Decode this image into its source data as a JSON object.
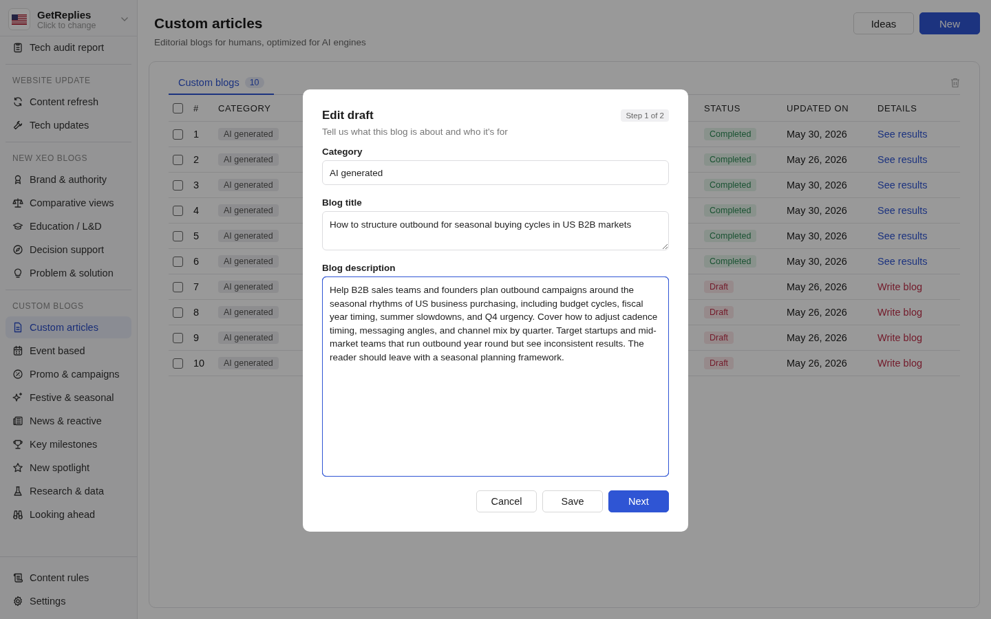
{
  "sidebar": {
    "workspace": {
      "name": "GetReplies",
      "subtitle": "Click to change"
    },
    "top_items": [
      {
        "label": "Tech audit report",
        "selected": false
      }
    ],
    "sections": [
      {
        "title": "WEBSITE UPDATE",
        "items": [
          {
            "label": "Content refresh",
            "selected": false
          },
          {
            "label": "Tech updates",
            "selected": false
          }
        ]
      },
      {
        "title": "NEW XEO BLOGS",
        "items": [
          {
            "label": "Brand & authority",
            "selected": false
          },
          {
            "label": "Comparative views",
            "selected": false
          },
          {
            "label": "Education / L&D",
            "selected": false
          },
          {
            "label": "Decision support",
            "selected": false
          },
          {
            "label": "Problem & solution",
            "selected": false
          }
        ]
      },
      {
        "title": "CUSTOM BLOGS",
        "items": [
          {
            "label": "Custom articles",
            "selected": true
          },
          {
            "label": "Event based",
            "selected": false
          },
          {
            "label": "Promo & campaigns",
            "selected": false
          },
          {
            "label": "Festive & seasonal",
            "selected": false
          },
          {
            "label": "News & reactive",
            "selected": false
          },
          {
            "label": "Key milestones",
            "selected": false
          },
          {
            "label": "New spotlight",
            "selected": false
          },
          {
            "label": "Research & data",
            "selected": false
          },
          {
            "label": "Looking ahead",
            "selected": false
          }
        ]
      }
    ],
    "bottom_items": [
      {
        "label": "Content rules",
        "selected": false
      },
      {
        "label": "Settings",
        "selected": false
      }
    ]
  },
  "header": {
    "title": "Custom articles",
    "subtitle": "Editorial blogs for humans, optimized for AI engines",
    "buttons": [
      {
        "label": "Ideas",
        "kind": "secondary"
      },
      {
        "label": "New",
        "kind": "primary"
      }
    ]
  },
  "tabs": [
    {
      "label": "Custom blogs",
      "count": "10",
      "selected": true
    }
  ],
  "table": {
    "select_all": {
      "checked": false
    },
    "columns": [
      "#",
      "CATEGORY",
      "STATUS",
      "UPDATED ON",
      "DETAILS"
    ],
    "rows": [
      {
        "checked": false,
        "number": "1",
        "category": "AI generated",
        "status": {
          "label": "Completed",
          "kind": "completed"
        },
        "updated": "May 30, 2026",
        "details": {
          "label": "See results",
          "kind": "results"
        }
      },
      {
        "checked": false,
        "number": "2",
        "category": "AI generated",
        "status": {
          "label": "Completed",
          "kind": "completed"
        },
        "updated": "May 26, 2026",
        "details": {
          "label": "See results",
          "kind": "results"
        }
      },
      {
        "checked": false,
        "number": "3",
        "category": "AI generated",
        "status": {
          "label": "Completed",
          "kind": "completed"
        },
        "updated": "May 30, 2026",
        "details": {
          "label": "See results",
          "kind": "results"
        }
      },
      {
        "checked": false,
        "number": "4",
        "category": "AI generated",
        "status": {
          "label": "Completed",
          "kind": "completed"
        },
        "updated": "May 30, 2026",
        "details": {
          "label": "See results",
          "kind": "results"
        }
      },
      {
        "checked": false,
        "number": "5",
        "category": "AI generated",
        "status": {
          "label": "Completed",
          "kind": "completed"
        },
        "updated": "May 30, 2026",
        "details": {
          "label": "See results",
          "kind": "results"
        }
      },
      {
        "checked": false,
        "number": "6",
        "category": "AI generated",
        "status": {
          "label": "Completed",
          "kind": "completed"
        },
        "updated": "May 30, 2026",
        "details": {
          "label": "See results",
          "kind": "results"
        }
      },
      {
        "checked": false,
        "number": "7",
        "category": "AI generated",
        "status": {
          "label": "Draft",
          "kind": "draft"
        },
        "updated": "May 26, 2026",
        "details": {
          "label": "Write blog",
          "kind": "write"
        }
      },
      {
        "checked": false,
        "number": "8",
        "category": "AI generated",
        "status": {
          "label": "Draft",
          "kind": "draft"
        },
        "updated": "May 26, 2026",
        "details": {
          "label": "Write blog",
          "kind": "write"
        }
      },
      {
        "checked": false,
        "number": "9",
        "category": "AI generated",
        "status": {
          "label": "Draft",
          "kind": "draft"
        },
        "updated": "May 26, 2026",
        "details": {
          "label": "Write blog",
          "kind": "write"
        }
      },
      {
        "checked": false,
        "number": "10",
        "category": "AI generated",
        "status": {
          "label": "Draft",
          "kind": "draft"
        },
        "updated": "May 26, 2026",
        "details": {
          "label": "Write blog",
          "kind": "write"
        }
      }
    ]
  },
  "modal": {
    "title": "Edit draft",
    "step": "Step 1 of 2",
    "subtitle": "Tell us what this blog is about and who it's for",
    "fields": [
      {
        "label": "Category",
        "value": "AI generated",
        "kind": "input"
      },
      {
        "label": "Blog title",
        "value": "How to structure outbound for seasonal buying cycles in US B2B markets",
        "kind": "textarea"
      },
      {
        "label": "Blog description",
        "value": "Help B2B sales teams and founders plan outbound campaigns around the seasonal rhythms of US business purchasing, including budget cycles, fiscal year timing, summer slowdowns, and Q4 urgency. Cover how to adjust cadence timing, messaging angles, and channel mix by quarter. Target startups and mid-market teams that run outbound year round but see inconsistent results. The reader should leave with a seasonal planning framework.",
        "kind": "textarea-large",
        "focused": true
      }
    ],
    "buttons": [
      {
        "label": "Cancel",
        "kind": "secondary"
      },
      {
        "label": "Save",
        "kind": "secondary"
      },
      {
        "label": "Next",
        "kind": "primary"
      }
    ]
  }
}
